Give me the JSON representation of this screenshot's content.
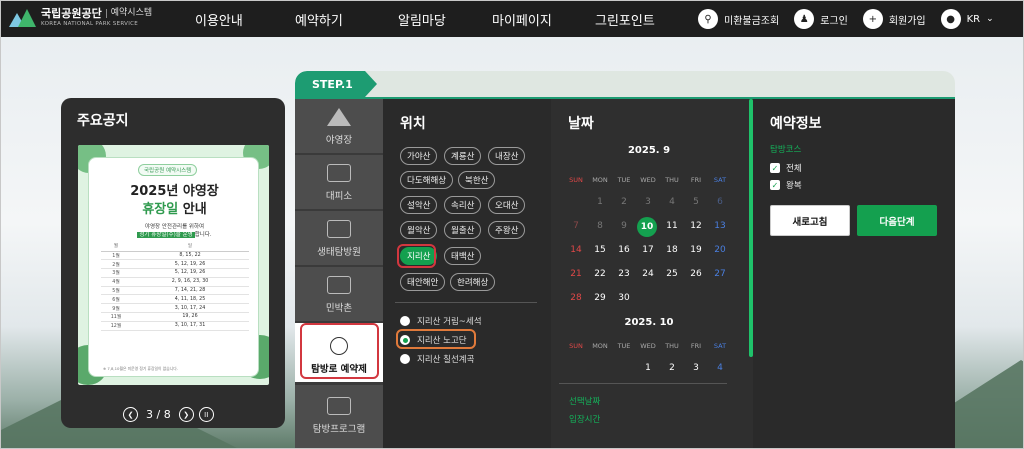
{
  "header": {
    "logo_name": "국립공원공단",
    "logo_sub": "예약시스템",
    "logo_en": "KOREA NATIONAL PARK SERVICE",
    "nav": [
      "이용안내",
      "예약하기",
      "알림마당",
      "마이페이지",
      "그린포인트"
    ],
    "util": {
      "unpaid": "미환불금조회",
      "login": "로그인",
      "signup": "회원가입",
      "lang": "KR"
    }
  },
  "notice": {
    "title": "주요공지",
    "poster": {
      "tag": "국립공원 예약시스템",
      "line1": "2025년 야영장",
      "line2_hl": "휴장일",
      "line2_rest": " 안내",
      "sub1": "야영장 안전관리를 위하여",
      "sub2_hl": "정기 휴장일(수)을 운영",
      "sub2_rest": "합니다.",
      "col_month": "월",
      "col_days": "일",
      "rows": [
        {
          "m": "1월",
          "d": "8, 15, 22"
        },
        {
          "m": "2월",
          "d": "5, 12, 19, 26"
        },
        {
          "m": "3월",
          "d": "5, 12, 19, 26"
        },
        {
          "m": "4월",
          "d": "2, 9, 16, 23, 30"
        },
        {
          "m": "5월",
          "d": "7, 14, 21, 28"
        },
        {
          "m": "6월",
          "d": "4, 11, 18, 25"
        },
        {
          "m": "9월",
          "d": "3, 10, 17, 24"
        },
        {
          "m": "11월",
          "d": "19, 26"
        },
        {
          "m": "12월",
          "d": "3, 10, 17, 31"
        }
      ],
      "footnote": "※ 7,8,10월은 미운영 정기 휴장일이 없습니다."
    },
    "pager": {
      "current": "3",
      "sep": "/",
      "total": "8"
    }
  },
  "booking": {
    "step": "STEP.1",
    "categories": [
      "야영장",
      "대피소",
      "생태탐방원",
      "민박촌",
      "탐방로 예약제",
      "탐방프로그램"
    ],
    "active_category": "탐방로 예약제",
    "location": {
      "title": "위치",
      "mountains": [
        "가야산",
        "계룡산",
        "내장산",
        "다도해해상",
        "북한산",
        "설악산",
        "속리산",
        "오대산",
        "월악산",
        "월출산",
        "주왕산",
        "지리산",
        "태백산",
        "태안해안",
        "한려해상"
      ],
      "selected": "지리산",
      "courses": [
        "지리산 거림~세석",
        "지리산 노고단",
        "지리산 칠선계곡"
      ],
      "selected_course": "지리산 노고단"
    },
    "date": {
      "title": "날짜",
      "weekdays": [
        "SUN",
        "MON",
        "TUE",
        "WED",
        "THU",
        "FRI",
        "SAT"
      ],
      "month1": {
        "label": "2025. 9",
        "rows": [
          [
            "",
            "1",
            "2",
            "3",
            "4",
            "5",
            "6"
          ],
          [
            "7",
            "8",
            "9",
            "10",
            "11",
            "12",
            "13"
          ],
          [
            "14",
            "15",
            "16",
            "17",
            "18",
            "19",
            "20"
          ],
          [
            "21",
            "22",
            "23",
            "24",
            "25",
            "26",
            "27"
          ],
          [
            "28",
            "29",
            "30",
            "",
            "",
            "",
            ""
          ]
        ],
        "today": "10"
      },
      "month2": {
        "label": "2025. 10",
        "rows": [
          [
            "",
            "",
            "",
            "1",
            "2",
            "3",
            "4"
          ]
        ]
      },
      "selected_date_label": "선택날짜",
      "entry_time_label": "입장시간"
    },
    "reservation": {
      "title": "예약정보",
      "course_label": "탐방코스",
      "options": [
        "전체",
        "왕복"
      ],
      "reset": "새로고침",
      "next": "다음단계"
    }
  }
}
